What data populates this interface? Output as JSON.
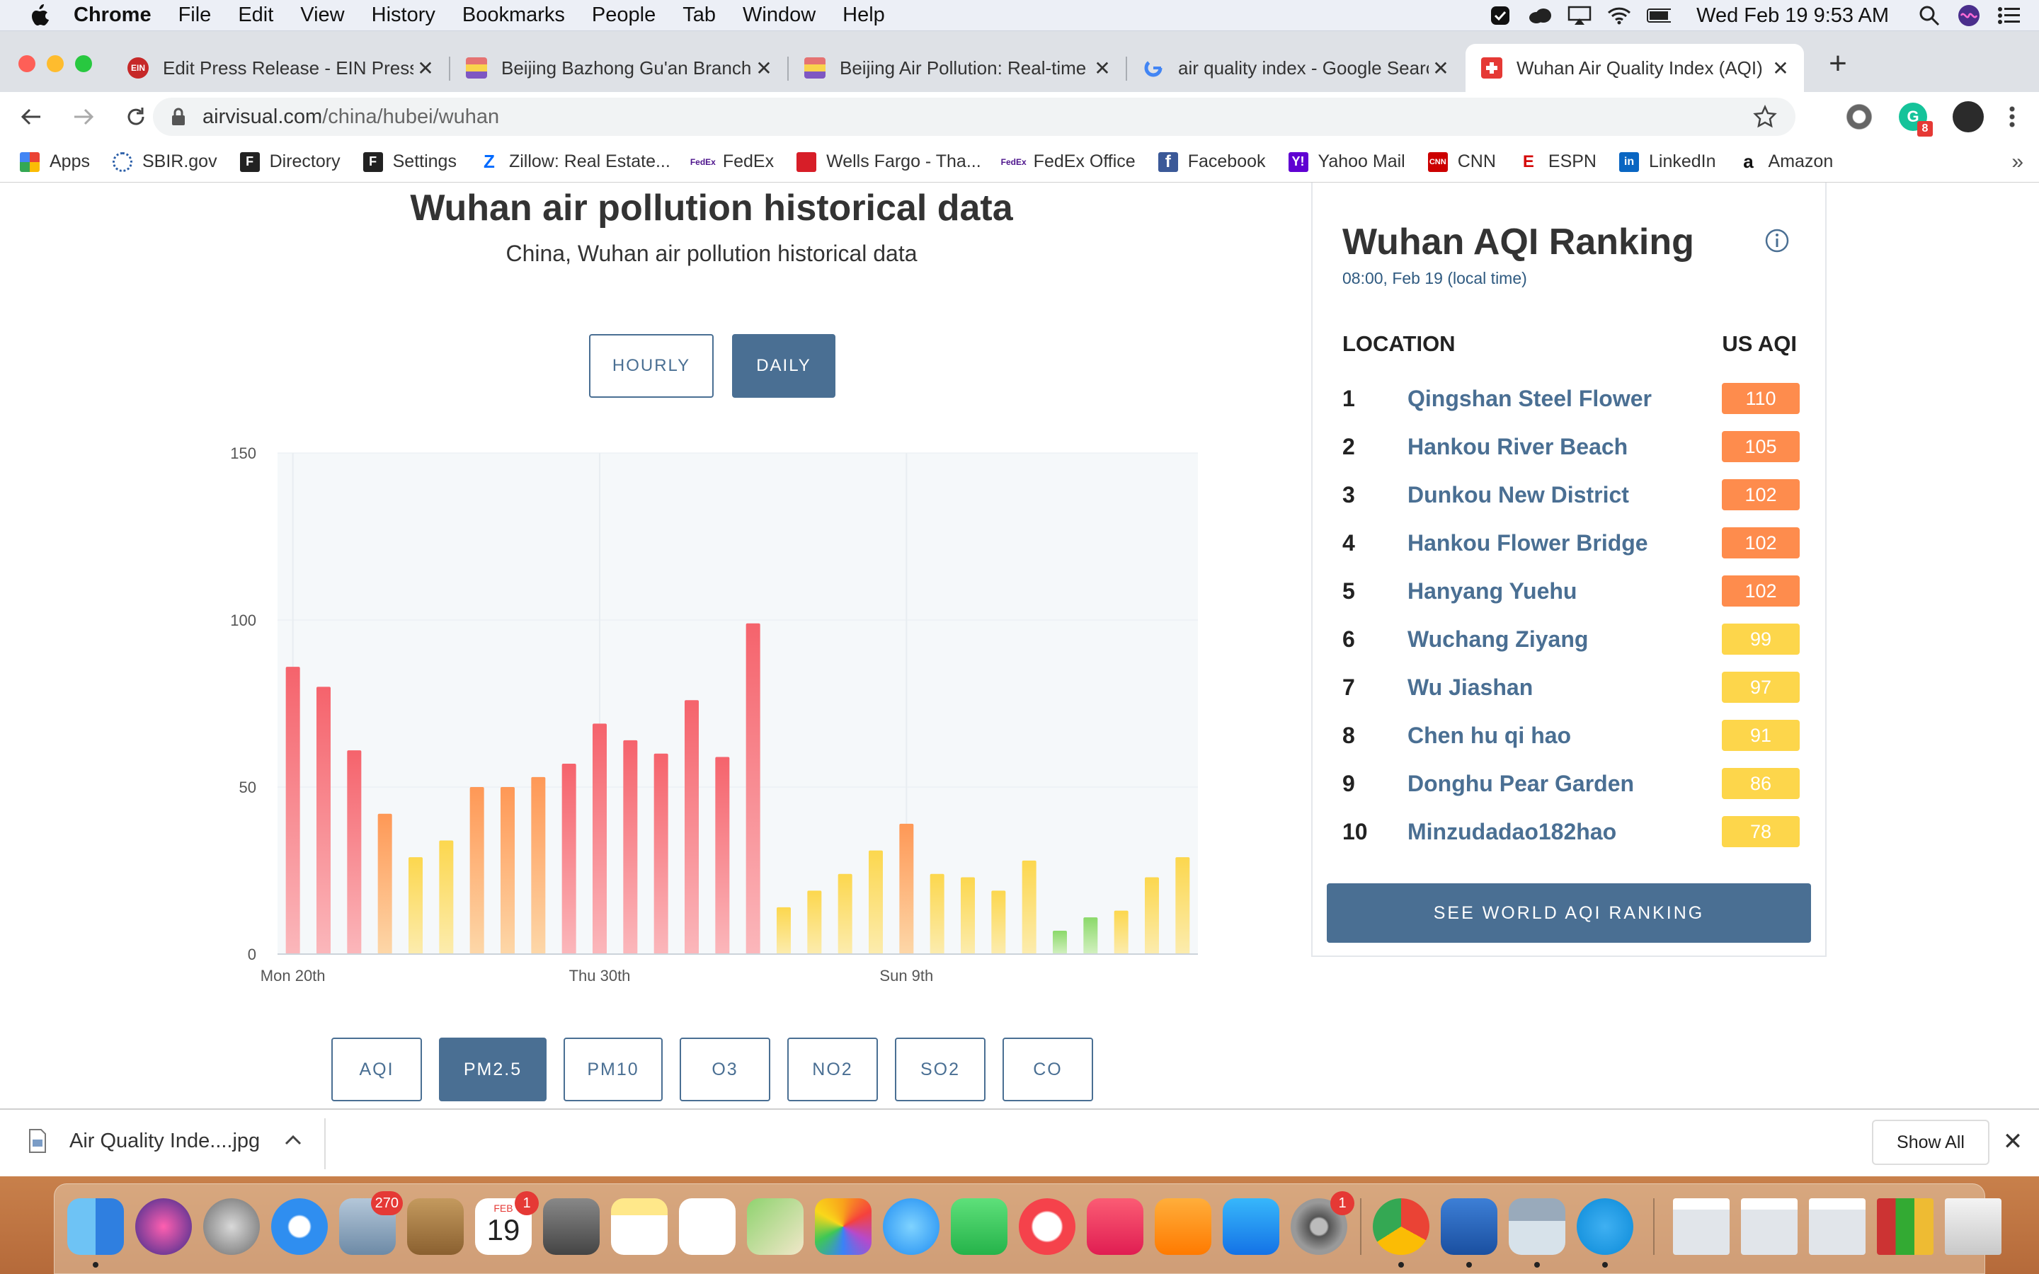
{
  "menubar": {
    "items": [
      "Chrome",
      "File",
      "Edit",
      "View",
      "History",
      "Bookmarks",
      "People",
      "Tab",
      "Window",
      "Help"
    ],
    "clock": "Wed Feb 19  9:53 AM"
  },
  "tabs": [
    {
      "title": "Edit Press Release - EIN Presswire",
      "icon": "ein-icon"
    },
    {
      "title": "Beijing Bazhong Gu'an Branch,",
      "icon": "beijing-flag-icon"
    },
    {
      "title": "Beijing Air Pollution: Real-time",
      "icon": "beijing-flag-icon"
    },
    {
      "title": "air quality index - Google Search",
      "icon": "google-icon"
    },
    {
      "title": "Wuhan Air Quality Index (AQI) and",
      "icon": "airvisual-icon"
    }
  ],
  "address": {
    "domain": "airvisual.com",
    "path": "/china/hubei/wuhan"
  },
  "profile_badge": "8",
  "bookmarks": [
    "Apps",
    "SBIR.gov",
    "Directory",
    "Settings",
    "Zillow: Real Estate...",
    "FedEx",
    "Wells Fargo - Tha...",
    "FedEx Office",
    "Facebook",
    "Yahoo Mail",
    "CNN",
    "ESPN",
    "LinkedIn",
    "Amazon"
  ],
  "history": {
    "title": "Wuhan air pollution historical data",
    "subtitle": "China, Wuhan air pollution historical data",
    "toggle": [
      {
        "label": "HOURLY",
        "selected": false
      },
      {
        "label": "DAILY",
        "selected": true
      }
    ],
    "pollutants": [
      {
        "label": "AQI",
        "selected": false
      },
      {
        "label": "PM2.5",
        "selected": true
      },
      {
        "label": "PM10",
        "selected": false
      },
      {
        "label": "O3",
        "selected": false
      },
      {
        "label": "NO2",
        "selected": false
      },
      {
        "label": "SO2",
        "selected": false
      },
      {
        "label": "CO",
        "selected": false
      }
    ]
  },
  "chart_data": {
    "type": "bar",
    "title": "",
    "xlabel": "",
    "ylabel": "",
    "ylim": [
      0,
      150
    ],
    "yticks": [
      0,
      50,
      100,
      150
    ],
    "x_tick_labels": [
      {
        "label": "Mon 20th",
        "index": 0
      },
      {
        "label": "Thu 30th",
        "index": 10
      },
      {
        "label": "Sun 9th",
        "index": 20
      }
    ],
    "values": [
      86,
      80,
      61,
      42,
      29,
      34,
      50,
      50,
      53,
      57,
      69,
      64,
      60,
      76,
      59,
      99,
      14,
      19,
      24,
      31,
      39,
      24,
      23,
      19,
      28,
      7,
      11,
      13,
      23,
      29
    ],
    "grid": true,
    "legend": "none"
  },
  "ranking": {
    "title": "Wuhan AQI Ranking",
    "time": "08:00, Feb 19 (local time)",
    "col_location": "LOCATION",
    "col_aqi": "US AQI",
    "rows": [
      {
        "rank": "1",
        "location": "Qingshan Steel Flower",
        "aqi": 110,
        "color": "#fe8c4d"
      },
      {
        "rank": "2",
        "location": "Hankou River Beach",
        "aqi": 105,
        "color": "#fe8c4d"
      },
      {
        "rank": "3",
        "location": "Dunkou New District",
        "aqi": 102,
        "color": "#fe8c4d"
      },
      {
        "rank": "4",
        "location": "Hankou Flower Bridge",
        "aqi": 102,
        "color": "#fe8c4d"
      },
      {
        "rank": "5",
        "location": "Hanyang Yuehu",
        "aqi": 102,
        "color": "#fe8c4d"
      },
      {
        "rank": "6",
        "location": "Wuchang Ziyang",
        "aqi": 99,
        "color": "#fdd64b"
      },
      {
        "rank": "7",
        "location": "Wu Jiashan",
        "aqi": 97,
        "color": "#fdd64b"
      },
      {
        "rank": "8",
        "location": "Chen hu qi hao",
        "aqi": 91,
        "color": "#fdd64b"
      },
      {
        "rank": "9",
        "location": "Donghu Pear Garden",
        "aqi": 86,
        "color": "#fdd64b"
      },
      {
        "rank": "10",
        "location": "Minzudadao182hao",
        "aqi": 78,
        "color": "#fdd64b"
      }
    ],
    "button": "SEE WORLD AQI RANKING"
  },
  "downloads": {
    "file": "Air Quality Inde....jpg",
    "show_all": "Show All"
  },
  "dock": {
    "apps": [
      "finder",
      "siri",
      "launchpad",
      "safari",
      "mail",
      "contacts",
      "calendar",
      "calculator",
      "notes",
      "reminders",
      "maps",
      "photos",
      "messages",
      "facetime",
      "news",
      "music",
      "books",
      "app-store",
      "system-preferences",
      "chrome",
      "word",
      "preview",
      "skype"
    ],
    "badges": {
      "mail": "270",
      "calendar": "1",
      "system-preferences": "1"
    },
    "calendar_day": "19",
    "calendar_month": "FEB"
  },
  "colors": {
    "accent": "#4a6f93",
    "orange": "#fe8c4d",
    "yellow": "#fdd64b",
    "green": "#8bd96a",
    "red": "#f5636c"
  }
}
